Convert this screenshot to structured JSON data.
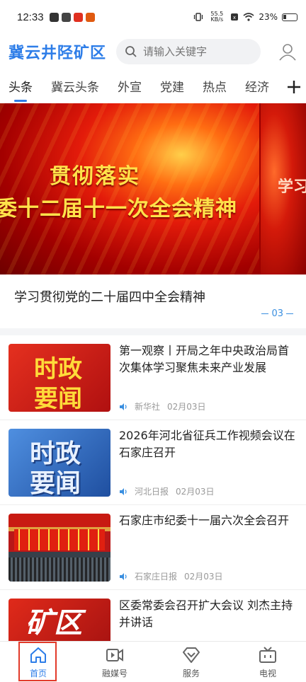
{
  "status_bar": {
    "time": "12:33",
    "net_speed": "55.5 KB/s",
    "battery": "23%"
  },
  "header": {
    "brand": "冀云井陉矿区",
    "search_placeholder": "请输入关键字"
  },
  "tabs": [
    "头条",
    "冀云头条",
    "外宣",
    "党建",
    "热点",
    "经济"
  ],
  "active_tab": "头条",
  "banner": {
    "slide_line1": "贯彻落实",
    "slide_line2": "委十二届十一次全会精神",
    "next_slide_peek": "学习",
    "caption": "学习贯彻党的二十届四中全会精神",
    "page_indicator": "03"
  },
  "news": [
    {
      "title": "第一观察丨开局之年中央政治局首次集体学习聚焦未来产业发展",
      "source": "新华社",
      "date": "02月03日",
      "thumb_style": "red",
      "thumb_line1": "时政",
      "thumb_line2": "要闻"
    },
    {
      "title": "2026年河北省征兵工作视频会议在石家庄召开",
      "source": "河北日报",
      "date": "02月03日",
      "thumb_style": "blue",
      "thumb_line1": "时政",
      "thumb_line2": "要闻"
    },
    {
      "title": "石家庄市纪委十一届六次全会召开",
      "source": "石家庄日报",
      "date": "02月03日",
      "thumb_style": "meeting"
    },
    {
      "title": "区委常委会召开扩大会议 刘杰主持并讲话",
      "thumb_style": "kuang",
      "thumb_line1": "矿区"
    }
  ],
  "bottom_nav": [
    {
      "label": "首页",
      "icon": "home-icon",
      "active": true
    },
    {
      "label": "融媒号",
      "icon": "video-icon",
      "active": false
    },
    {
      "label": "服务",
      "icon": "service-icon",
      "active": false
    },
    {
      "label": "电视",
      "icon": "tv-icon",
      "active": false
    }
  ],
  "colors": {
    "accent": "#2d7de8",
    "banner_red": "#c8100a"
  }
}
